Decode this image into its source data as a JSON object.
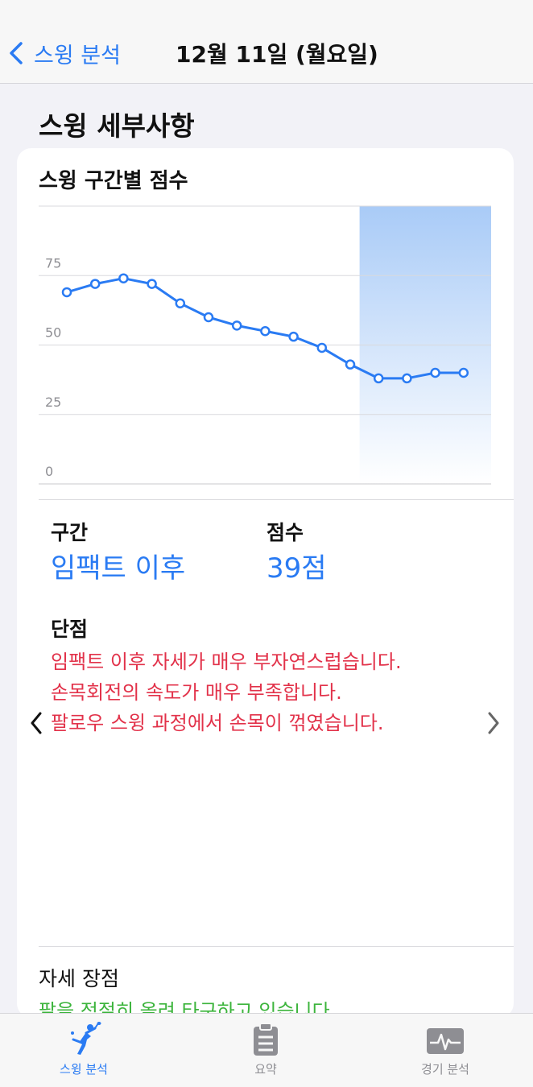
{
  "nav": {
    "back_label": "스윙 분석",
    "title": "12월 11일 (월요일)"
  },
  "section_title": "스윙 세부사항",
  "card": {
    "title": "스윙 구간별 점수"
  },
  "chart_data": {
    "type": "line",
    "title": "스윙 구간별 점수",
    "xlabel": "",
    "ylabel": "",
    "ylim": [
      0,
      100
    ],
    "yticks": [
      0,
      25,
      50,
      75
    ],
    "grid": true,
    "highlight_range": [
      11,
      14
    ],
    "highlight_color": "#a9cbf7",
    "line_color": "#2a7bf3",
    "x": [
      1,
      2,
      3,
      4,
      5,
      6,
      7,
      8,
      9,
      10,
      11,
      12,
      13,
      14,
      15
    ],
    "values": [
      69,
      72,
      74,
      72,
      65,
      60,
      57,
      55,
      53,
      49,
      43,
      38,
      38,
      40,
      40
    ]
  },
  "detail": {
    "segment_label": "구간",
    "segment_value": "임팩트 이후",
    "score_label": "점수",
    "score_value": "39점"
  },
  "faults": {
    "label": "단점",
    "items": [
      "임팩트 이후 자세가 매우 부자연스럽습니다.",
      "손목회전의 속도가 매우 부족합니다.",
      "팔로우 스윙 과정에서 손목이 꺾였습니다."
    ],
    "color": "#e2324a"
  },
  "strengths": {
    "label": "자세 장점",
    "first_item": "팔을 적절히 올려 타구하고 있습니다.",
    "color": "#3cb43c"
  },
  "tabs": [
    {
      "label": "스윙 분석",
      "icon": "badminton-player-icon",
      "active": true
    },
    {
      "label": "요약",
      "icon": "clipboard-icon",
      "active": false
    },
    {
      "label": "경기 분석",
      "icon": "waveform-monitor-icon",
      "active": false
    }
  ],
  "colors": {
    "accent": "#2a7bf3",
    "fault": "#e2324a",
    "good": "#3cb43c"
  }
}
